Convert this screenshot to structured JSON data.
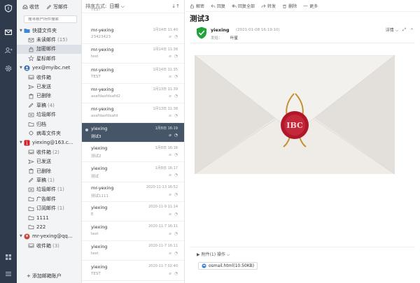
{
  "rail": {
    "icons": [
      "shield-logo",
      "mail",
      "contacts",
      "settings",
      "apps",
      "menu"
    ]
  },
  "folders": {
    "toolbar": {
      "inbox_label": "收信",
      "compose_label": "写邮件"
    },
    "search_placeholder": "搜寻账户所件搜索",
    "quick": {
      "label": "快捷文件夹",
      "items": [
        {
          "label": "未读邮件",
          "count": "(15)"
        },
        {
          "label": "加密邮件",
          "count": ""
        },
        {
          "label": "星标邮件",
          "count": ""
        }
      ]
    },
    "account1": {
      "label": "yex@myibc.net",
      "items": [
        {
          "label": "收件箱",
          "count": ""
        },
        {
          "label": "已发送",
          "count": ""
        },
        {
          "label": "已删除",
          "count": ""
        },
        {
          "label": "草稿",
          "count": "(4)"
        },
        {
          "label": "垃圾邮件",
          "count": ""
        },
        {
          "label": "归档",
          "count": ""
        },
        {
          "label": "病毒文件夹",
          "count": ""
        }
      ]
    },
    "account2": {
      "label": "yiexing@163.c...",
      "items": [
        {
          "label": "收件箱",
          "count": "(2)"
        },
        {
          "label": "已发送",
          "count": ""
        },
        {
          "label": "已删除",
          "count": ""
        },
        {
          "label": "草稿",
          "count": "(1)"
        },
        {
          "label": "垃圾邮件",
          "count": "(1)"
        },
        {
          "label": "广告邮件",
          "count": ""
        },
        {
          "label": "订阅邮件",
          "count": "(1)"
        },
        {
          "label": "1111",
          "count": ""
        },
        {
          "label": "222",
          "count": ""
        }
      ]
    },
    "account3": {
      "label": "mr-yexing@qq...",
      "items": [
        {
          "label": "收件箱",
          "count": "(3)"
        }
      ]
    },
    "add_account": "添加邮箱账户"
  },
  "list": {
    "sort_label": "排序方式:",
    "sort_value": "日期",
    "messages": [
      {
        "from": "",
        "date": "",
        "subject": "TEST",
        "selected": false
      },
      {
        "from": "mr-yexing",
        "date": "1月14日 11:40",
        "subject": "23423423",
        "selected": false
      },
      {
        "from": "mr-yexing",
        "date": "1月14日 11:38",
        "subject": "test",
        "selected": false
      },
      {
        "from": "mr-yexing",
        "date": "1月14日 11:35",
        "subject": "TEST",
        "selected": false
      },
      {
        "from": "mr-yexing",
        "date": "1月13日 11:39",
        "subject": "asafdasfdsafd2",
        "selected": false
      },
      {
        "from": "mr-yexing",
        "date": "1月13日 11:38",
        "subject": "asafdasfdsafd",
        "selected": false
      },
      {
        "from": "yiexing",
        "date": "1月8日 16:19",
        "subject": "测试3",
        "selected": true
      },
      {
        "from": "yiexing",
        "date": "1月8日 16:18",
        "subject": "测试2",
        "selected": false
      },
      {
        "from": "yiexing",
        "date": "1月8日 16:17",
        "subject": "测试",
        "selected": false
      },
      {
        "from": "mr-yexing",
        "date": "2020-11-13 16:52",
        "subject": "测试1111",
        "selected": false
      },
      {
        "from": "yiexing",
        "date": "2020-11-9 11:14",
        "subject": "E",
        "selected": false
      },
      {
        "from": "yiexing",
        "date": "2020-11-7 16:11",
        "subject": "test",
        "selected": false
      },
      {
        "from": "yiexing",
        "date": "2020-11-7 16:11",
        "subject": "test",
        "selected": false
      },
      {
        "from": "yiexing",
        "date": "2020-11-7 02:40",
        "subject": "TEST",
        "selected": false
      }
    ]
  },
  "read": {
    "toolbar": [
      "解密",
      "回复",
      "回复全部",
      "转发",
      "删除",
      "更多"
    ],
    "title": "测试3",
    "sender": "yiexing",
    "send_date": "(2021-01-08 16:19:10)",
    "recv_label": "发给：",
    "recv_name": "叶星",
    "detail_label": "详情",
    "seal_text": "IBC",
    "attach_label": "附件(1)  操作",
    "attach_file": "osmail.html(10.50KB)",
    "colors": {
      "accent": "#475569",
      "shield": "#22a33a",
      "seal": "#b0182a"
    }
  }
}
